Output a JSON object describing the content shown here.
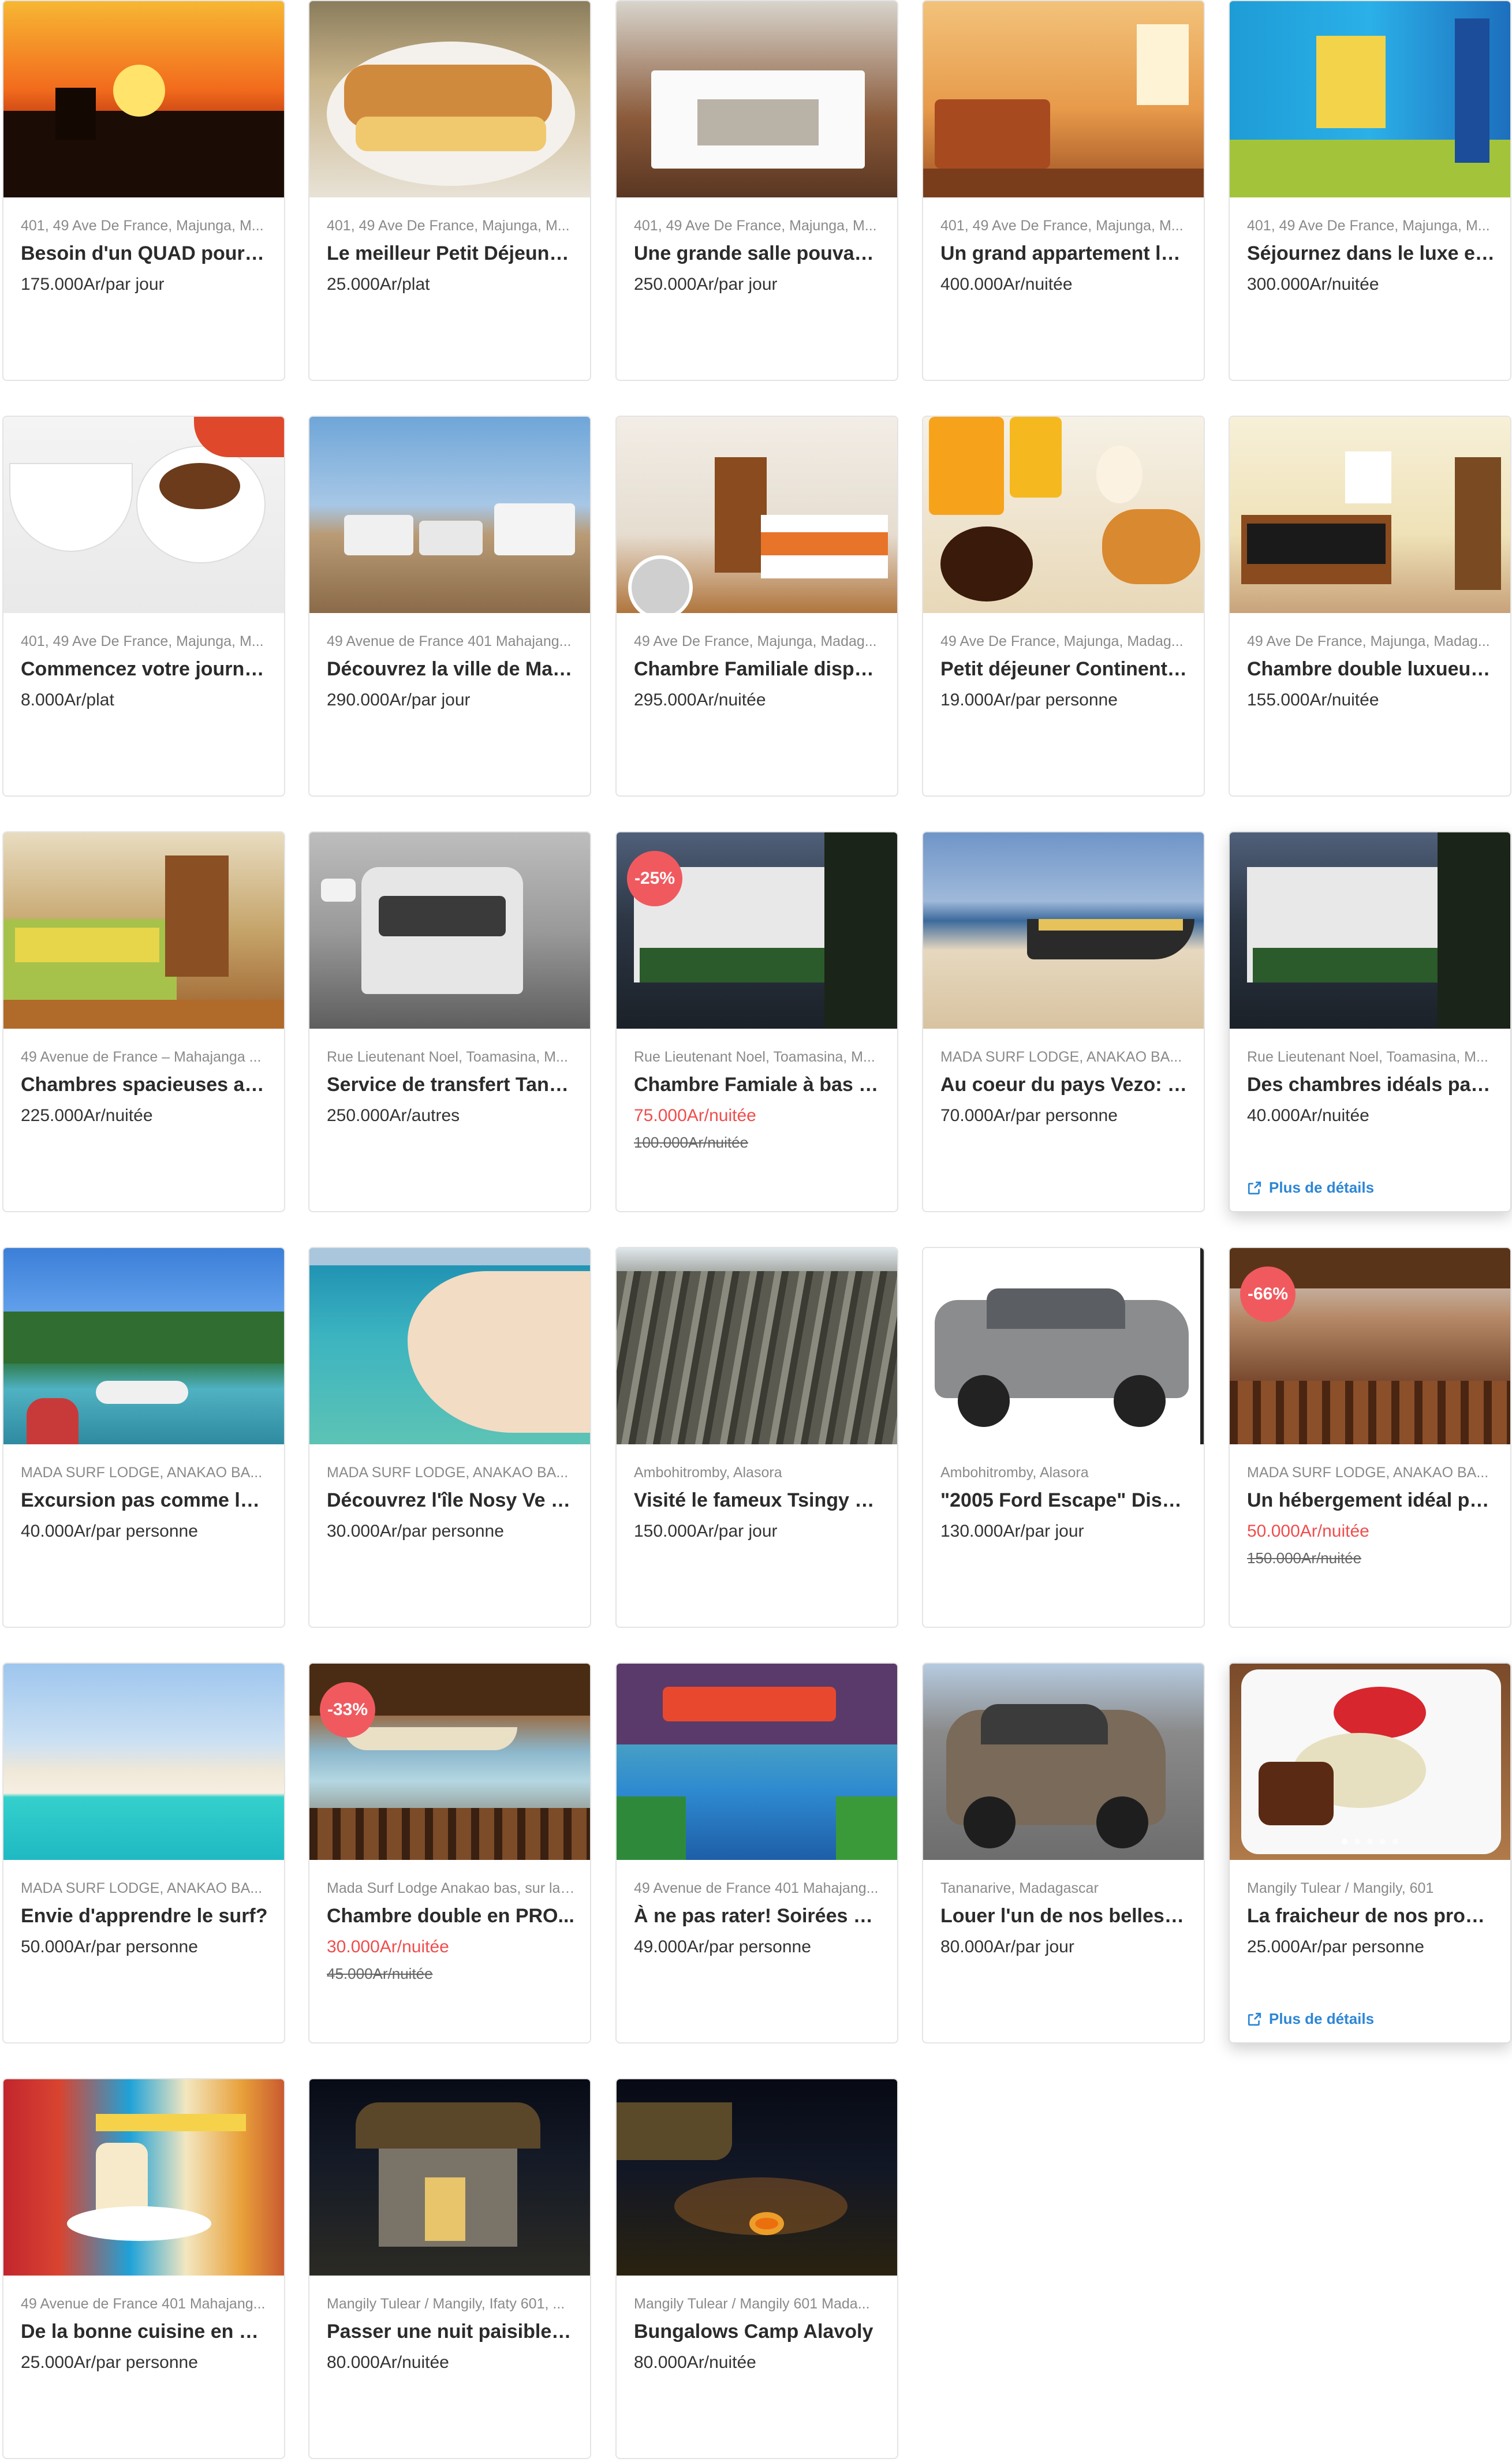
{
  "details_label": "Plus de détails",
  "colors": {
    "sale": "#f04d4d",
    "badge": "#f05a5f",
    "link": "#2d86d6",
    "border": "#e4e4e4"
  },
  "listings": [
    {
      "address": "401, 49 Ave De France, Majunga, M...",
      "title": "Besoin d'un QUAD pour p...",
      "price": "175.000Ar/par jour",
      "image": "quad-sunset"
    },
    {
      "address": "401, 49 Ave De France, Majunga, M...",
      "title": "Le meilleur Petit Déjeuner...",
      "price": "25.000Ar/plat",
      "image": "breakfast-sandwich"
    },
    {
      "address": "401, 49 Ave De France, Majunga, M...",
      "title": "Une grande salle pouvant ...",
      "price": "250.000Ar/par jour",
      "image": "conference-room"
    },
    {
      "address": "401, 49 Ave De France, Majunga, M...",
      "title": "Un grand appartement lux...",
      "price": "400.000Ar/nuitée",
      "image": "apartment"
    },
    {
      "address": "401, 49 Ave De France, Majunga, M...",
      "title": "Séjournez dans le luxe en r...",
      "price": "300.000Ar/nuitée",
      "image": "luxury-room"
    },
    {
      "address": "401, 49 Ave De France, Majunga, M...",
      "title": "Commencez votre journée...",
      "price": "8.000Ar/plat",
      "image": "bowls"
    },
    {
      "address": "49 Avenue de France 401 Mahajang...",
      "title": "Découvrez la ville de Mah...",
      "price": "290.000Ar/par jour",
      "image": "jeeps"
    },
    {
      "address": "49 Ave De France, Majunga, Madag...",
      "title": "Chambre Familiale dispon...",
      "price": "295.000Ar/nuitée",
      "image": "family-room"
    },
    {
      "address": "49 Ave De France, Majunga, Madag...",
      "title": "Petit déjeuner Continenta...",
      "price": "19.000Ar/par personne",
      "image": "continental-breakfast"
    },
    {
      "address": "49 Ave De France, Majunga, Madag...",
      "title": "Chambre double luxueux ...",
      "price": "155.000Ar/nuitée",
      "image": "double-room"
    },
    {
      "address": "49 Avenue de France – Mahajanga ...",
      "title": "Chambres spacieuses avec...",
      "price": "225.000Ar/nuitée",
      "image": "spacious-room"
    },
    {
      "address": "Rue Lieutenant Noel, Toamasina, M...",
      "title": "Service de transfert Tanan...",
      "price": "250.000Ar/autres",
      "image": "van-fog"
    },
    {
      "address": "Rue Lieutenant Noel, Toamasina, M...",
      "title": "Chambre Famiale à bas pri...",
      "price": "75.000Ar/nuitée",
      "old_price": "100.000Ar/nuitée",
      "badge": "-25%",
      "image": "hotel-night"
    },
    {
      "address": "MADA SURF LODGE, ANAKAO BA...",
      "title": "Au coeur du pays Vezo: un...",
      "price": "70.000Ar/par personne",
      "image": "pirogue-beach"
    },
    {
      "address": "Rue Lieutenant Noel, Toamasina, M...",
      "title": "Des chambres idéals pas tr...",
      "price": "40.000Ar/nuitée",
      "image": "hotel-night",
      "hover": true
    },
    {
      "address": "MADA SURF LODGE, ANAKAO BA...",
      "title": "Excursion pas comme les a...",
      "price": "40.000Ar/par personne",
      "image": "boats-lagoon"
    },
    {
      "address": "MADA SURF LODGE, ANAKAO BA...",
      "title": "Découvrez l'île Nosy Ve et...",
      "price": "30.000Ar/par personne",
      "image": "sandbar"
    },
    {
      "address": "Ambohitromby, Alasora",
      "title": "Visité le fameux Tsingy de ...",
      "price": "150.000Ar/par jour",
      "image": "tsingy"
    },
    {
      "address": "Ambohitromby, Alasora",
      "title": "\"2005 Ford Escape\" Dispo...",
      "price": "130.000Ar/par jour",
      "image": "suv-white"
    },
    {
      "address": "MADA SURF LODGE, ANAKAO BA...",
      "title": "Un hébergement idéal pou...",
      "price": "50.000Ar/nuitée",
      "old_price": "150.000Ar/nuitée",
      "badge": "-66%",
      "image": "terrace"
    },
    {
      "address": "MADA SURF LODGE, ANAKAO BA...",
      "title": "Envie d'apprendre le surf?",
      "price": "50.000Ar/par personne",
      "image": "turquoise-beach"
    },
    {
      "address": "Mada Surf Lodge Anakao bas, sur la ...",
      "title": "Chambre double en PRO...",
      "price": "30.000Ar/nuitée",
      "old_price": "45.000Ar/nuitée",
      "badge": "-33%",
      "image": "hammock"
    },
    {
      "address": "49 Avenue de France 401 Mahajang...",
      "title": "À ne pas rater! Soirées en ...",
      "price": "49.000Ar/par personne",
      "image": "pool-party"
    },
    {
      "address": "Tananarive, Madagascar",
      "title": "Louer l'un de nos belles 4x...",
      "price": "80.000Ar/par jour",
      "image": "car-lot"
    },
    {
      "address": "Mangily Tulear / Mangily, 601",
      "title": "La fraicheur de nos produi...",
      "price": "25.000Ar/par personne",
      "image": "salad-plate",
      "hover": true,
      "carousel": 5
    },
    {
      "address": "49 Avenue de France 401 Mahajang...",
      "title": "De la bonne cuisine en plei...",
      "price": "25.000Ar/par personne",
      "image": "food-collage"
    },
    {
      "address": "Mangily Tulear / Mangily, Ifaty 601, ...",
      "title": "Passer une nuit paisible au...",
      "price": "80.000Ar/nuitée",
      "image": "bungalow-night"
    },
    {
      "address": "Mangily Tulear / Mangily 601 Mada...",
      "title": "Bungalows Camp Alavoly",
      "price": "80.000Ar/nuitée",
      "image": "campfire"
    }
  ]
}
